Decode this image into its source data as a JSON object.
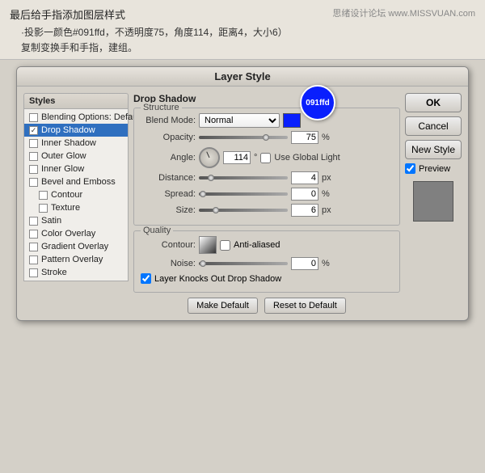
{
  "watermark": "思绪设计论坛 www.MISSVUAN.com",
  "top": {
    "title": "最后给手指添加图层样式",
    "desc1": "·投影一颜色#091ffd，不透明度75，角度114，距离4，大小6）",
    "desc2": "复制变换手和手指，建组。"
  },
  "dialog": {
    "title": "Layer Style",
    "styles_header": "Styles",
    "style_items": [
      {
        "label": "Blending Options: Default",
        "checked": false,
        "active": false,
        "level": 0
      },
      {
        "label": "Drop Shadow",
        "checked": true,
        "active": true,
        "level": 0
      },
      {
        "label": "Inner Shadow",
        "checked": false,
        "active": false,
        "level": 0
      },
      {
        "label": "Outer Glow",
        "checked": false,
        "active": false,
        "level": 0
      },
      {
        "label": "Inner Glow",
        "checked": false,
        "active": false,
        "level": 0
      },
      {
        "label": "Bevel and Emboss",
        "checked": false,
        "active": false,
        "level": 0
      },
      {
        "label": "Contour",
        "checked": false,
        "active": false,
        "level": 1
      },
      {
        "label": "Texture",
        "checked": false,
        "active": false,
        "level": 1
      },
      {
        "label": "Satin",
        "checked": false,
        "active": false,
        "level": 0
      },
      {
        "label": "Color Overlay",
        "checked": false,
        "active": false,
        "level": 0
      },
      {
        "label": "Gradient Overlay",
        "checked": false,
        "active": false,
        "level": 0
      },
      {
        "label": "Pattern Overlay",
        "checked": false,
        "active": false,
        "level": 0
      },
      {
        "label": "Stroke",
        "checked": false,
        "active": false,
        "level": 0
      }
    ],
    "drop_shadow": {
      "section": "Drop Shadow",
      "structure_label": "Structure",
      "blend_mode_label": "Blend Mode:",
      "blend_mode_value": "Normal",
      "opacity_label": "Opacity:",
      "opacity_value": "75",
      "opacity_unit": "%",
      "angle_label": "Angle:",
      "angle_value": "114",
      "angle_unit": "°",
      "use_global_light": "Use Global Light",
      "distance_label": "Distance:",
      "distance_value": "4",
      "distance_unit": "px",
      "spread_label": "Spread:",
      "spread_value": "0",
      "spread_unit": "%",
      "size_label": "Size:",
      "size_value": "6",
      "size_unit": "px",
      "quality_label": "Quality",
      "contour_label": "Contour:",
      "anti_aliased": "Anti-aliased",
      "noise_label": "Noise:",
      "noise_value": "0",
      "noise_unit": "%",
      "layer_knocks": "Layer Knocks Out Drop Shadow",
      "make_default": "Make Default",
      "reset_default": "Reset to Default"
    },
    "right": {
      "ok": "OK",
      "cancel": "Cancel",
      "new_style": "New Style",
      "preview_label": "Preview"
    },
    "color_badge": "091ffd"
  }
}
